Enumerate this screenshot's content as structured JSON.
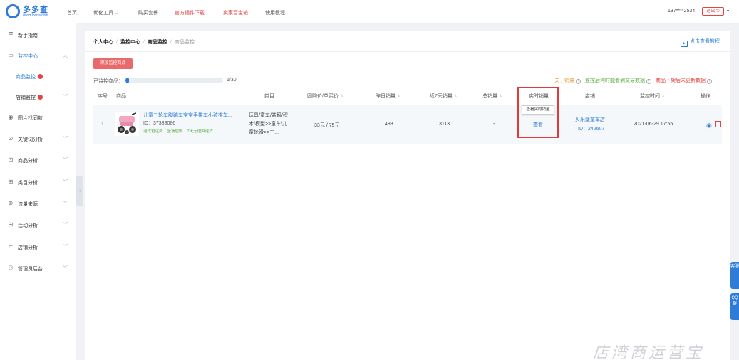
{
  "logo": {
    "text": "多多查",
    "sub": "duoduocha.com"
  },
  "nav": [
    {
      "label": "首页",
      "red": false
    },
    {
      "label": "优化工具 ⌄",
      "red": false
    },
    {
      "label": "购买套餐",
      "red": false
    },
    {
      "label": "官方插件下载",
      "red": true
    },
    {
      "label": "卖家百宝箱",
      "red": true
    },
    {
      "label": "使用教程",
      "red": false
    }
  ],
  "user": {
    "phone": "137****2534",
    "logout": "退出 ⎋",
    "caret": "▾"
  },
  "sidebar": {
    "items": [
      {
        "label": "新手指南",
        "icon": "☰",
        "chev": ""
      },
      {
        "label": "监控中心",
        "icon": "▭",
        "chev": "︿"
      },
      {
        "label": "商品监控",
        "icon": "",
        "chev": ""
      },
      {
        "label": "店铺监控",
        "icon": "",
        "chev": "﹀"
      },
      {
        "label": "图片找同款",
        "icon": "◉",
        "chev": ""
      },
      {
        "label": "关键词分析",
        "icon": "⊙",
        "chev": "﹀"
      },
      {
        "label": "商品分析",
        "icon": "⊡",
        "chev": "﹀"
      },
      {
        "label": "类目分析",
        "icon": "⊞",
        "chev": "﹀"
      },
      {
        "label": "流量来源",
        "icon": "⊚",
        "chev": "﹀"
      },
      {
        "label": "活动分析",
        "icon": "⊟",
        "chev": "﹀"
      },
      {
        "label": "店铺分析",
        "icon": "⊏",
        "chev": "﹀"
      },
      {
        "label": "管理员后台",
        "icon": "⚇",
        "chev": "﹀"
      }
    ],
    "handle": "‹"
  },
  "breadcrumb": [
    "个人中心",
    "监控中心",
    "商品监控",
    "商品监控"
  ],
  "tutorial": "点击查看教程",
  "tutorial_icon": "▶",
  "add_button": "添加监控商品",
  "monitored": {
    "label": "已监控商品：",
    "count": "1/30",
    "fraction": 0.033
  },
  "notes": [
    {
      "text": "关于销量",
      "color": "a"
    },
    {
      "text": "监控后何时能看到交易数据",
      "color": "b"
    },
    {
      "text": "商品下架后未更新数据",
      "color": "c"
    }
  ],
  "qmark": "?",
  "table": {
    "headers": [
      "序号",
      "商品",
      "类目",
      "团购价/单买价",
      "昨日销量",
      "近7天销量",
      "总销量",
      "实时销量",
      "店铺",
      "监控时间",
      "操作"
    ],
    "sort_icon": "⇕",
    "row": {
      "index": "1",
      "name": "儿童三轮车脚踏车宝宝手推车小孩推车...",
      "id": "ID：37338086",
      "tags": [
        "退货包运费",
        "全场包邮",
        "7天无理由退货",
        "..."
      ],
      "category": "玩具/童车/益智/积木/模型>>童车/儿童轮滑>>三...",
      "price": "33元 / 75元",
      "yesterday": "483",
      "week": "3113",
      "total": "-",
      "tooltip": "查看实时销量",
      "view": "查看",
      "shop_name": "贝乐堡童车店",
      "shop_id": "ID：242607",
      "time": "2021-06-29 17:55",
      "eye": "◉"
    }
  },
  "float": {
    "cs": "客服",
    "qq": "QQ群"
  },
  "watermark": "店湾商运营宝",
  "colors": {
    "accent": "#2f7bd8",
    "red": "#e84343",
    "add_button": "#e96a6a",
    "green": "#5aaa3c",
    "orange": "#e8a23a"
  }
}
